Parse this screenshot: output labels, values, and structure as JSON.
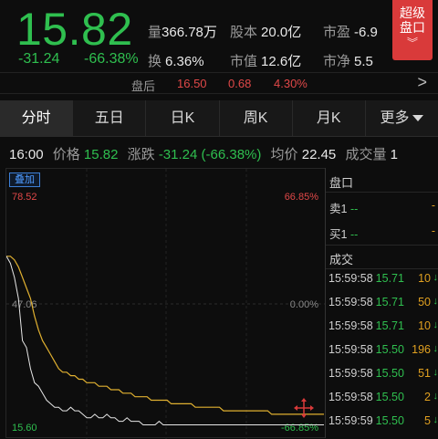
{
  "quote": {
    "price": "15.82",
    "change": "-31.24",
    "change_pct": "-66.38%",
    "volume_label": "量",
    "volume": "366.78万",
    "shares_label": "股本",
    "shares": "20.0亿",
    "pe_label": "市盈",
    "pe": "-6.9",
    "turnover_label": "换",
    "turnover": "6.36%",
    "mktcap_label": "市值",
    "mktcap": "12.6亿",
    "pb_label": "市净",
    "pb": "5.5"
  },
  "super_button": {
    "line1": "超级",
    "line2": "盘口",
    "chevron": "︾"
  },
  "after_hours": {
    "label": "盘后",
    "price": "16.50",
    "change": "0.68",
    "pct": "4.30%",
    "arrow": ">"
  },
  "tabs": [
    {
      "label": "分时",
      "active": true
    },
    {
      "label": "五日",
      "active": false
    },
    {
      "label": "日K",
      "active": false
    },
    {
      "label": "周K",
      "active": false
    },
    {
      "label": "月K",
      "active": false
    },
    {
      "label": "更多",
      "active": false
    }
  ],
  "info_row": {
    "time": "16:00",
    "price_label": "价格",
    "price": "15.82",
    "chg_label": "涨跌",
    "chg": "-31.24 (-66.38%)",
    "avg_label": "均价",
    "avg": "22.45",
    "vol_label": "成交量",
    "vol": "1"
  },
  "chart": {
    "overlay_label": "叠加",
    "y_high": "78.52",
    "y_high_pct": "66.85%",
    "y_mid": "47.06",
    "y_mid_pct": "0.00%",
    "y_low": "15.60",
    "y_low_pct": "-66.85%",
    "colors": {
      "price_line": "#e6e6e6",
      "avg_line": "#e0b030",
      "up": "#e04848",
      "down": "#2fbf4f"
    }
  },
  "chart_data": {
    "type": "line",
    "ylim": [
      15.6,
      78.52
    ],
    "y_ticks": [
      "78.52",
      "47.06",
      "15.60"
    ],
    "y_pct_ticks": [
      "66.85%",
      "0.00%",
      "-66.85%"
    ],
    "series": [
      {
        "values": [
          64,
          64,
          63,
          61,
          58,
          55,
          52,
          47,
          43,
          40,
          38,
          36,
          34,
          32,
          31,
          31,
          30,
          30,
          29,
          29,
          28,
          28,
          28,
          27,
          27,
          27,
          26,
          26,
          26,
          25,
          25,
          25,
          24,
          24,
          24,
          24,
          23,
          23,
          23,
          23,
          23,
          22,
          22,
          22,
          22,
          22,
          22,
          21,
          21,
          21,
          21,
          21,
          21,
          21,
          20,
          20,
          20,
          20,
          20,
          20,
          20,
          20,
          20,
          20,
          20,
          20,
          19,
          19,
          19,
          19,
          19,
          19,
          19,
          19,
          19,
          19,
          19,
          19,
          19,
          19
        ]
      },
      {
        "values": [
          64,
          62,
          58,
          52,
          40,
          38,
          32,
          28,
          27,
          25,
          23,
          22,
          21,
          21,
          20,
          20,
          21,
          20,
          20,
          19,
          18,
          18,
          19,
          18,
          18,
          19,
          18,
          18,
          17,
          17,
          18,
          17,
          17,
          17,
          16,
          16,
          16,
          16,
          17,
          16,
          16,
          16,
          16,
          16,
          16,
          16,
          16,
          16,
          16,
          16,
          16,
          16,
          16,
          16,
          16,
          16,
          16,
          16,
          16,
          16,
          16,
          16,
          16,
          16,
          16,
          16,
          16,
          16,
          16,
          16,
          16,
          16,
          16,
          16,
          16,
          16,
          16,
          16,
          16,
          16
        ]
      }
    ]
  },
  "order_book": {
    "title": "盘口",
    "sell1_label": "卖1",
    "sell1_val": "--",
    "sell1_vol": "-",
    "buy1_label": "买1",
    "buy1_val": "--",
    "buy1_vol": "-",
    "trades_title": "成交",
    "trades": [
      {
        "time": "15:59:58",
        "price": "15.71",
        "vol": "10"
      },
      {
        "time": "15:59:58",
        "price": "15.71",
        "vol": "50"
      },
      {
        "time": "15:59:58",
        "price": "15.71",
        "vol": "10"
      },
      {
        "time": "15:59:58",
        "price": "15.50",
        "vol": "196"
      },
      {
        "time": "15:59:58",
        "price": "15.50",
        "vol": "51"
      },
      {
        "time": "15:59:58",
        "price": "15.50",
        "vol": "2"
      },
      {
        "time": "15:59:59",
        "price": "15.50",
        "vol": "5"
      }
    ],
    "arrow": "↓"
  }
}
